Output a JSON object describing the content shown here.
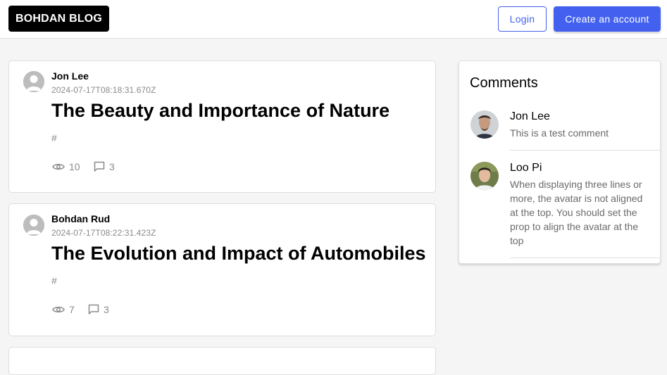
{
  "header": {
    "logo": "BOHDAN BLOG",
    "login_label": "Login",
    "create_label": "Create an account",
    "accent_color": "#4361ee"
  },
  "posts": [
    {
      "author": "Jon Lee",
      "date": "2024-07-17T08:18:31.670Z",
      "title": "The Beauty and Importance of Nature",
      "tag": "#",
      "views": "10",
      "comments": "3",
      "avatar_icon": "default-user-avatar"
    },
    {
      "author": "Bohdan Rud",
      "date": "2024-07-17T08:22:31.423Z",
      "title": "The Evolution and Impact of Automobiles",
      "tag": "#",
      "views": "7",
      "comments": "3",
      "avatar_icon": "default-user-avatar"
    }
  ],
  "sidebar": {
    "title": "Comments",
    "items": [
      {
        "name": "Jon Lee",
        "text": "This is a test comment"
      },
      {
        "name": "Loo Pi",
        "text": "When displaying three lines or more, the avatar is not aligned at the top. You should set the prop to align the avatar at the top"
      }
    ]
  },
  "icons": {
    "views": "eye-icon",
    "comments": "comment-icon"
  }
}
